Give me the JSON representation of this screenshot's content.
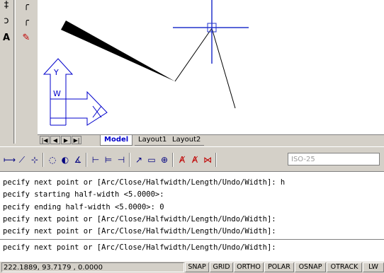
{
  "left_tools_a": [
    "‡",
    "ᴐ",
    "A"
  ],
  "left_tools_b": [
    "╭",
    "╭",
    "✎"
  ],
  "canvas": {
    "ucs_labels": {
      "y": "Y",
      "w": "W"
    }
  },
  "tabs": {
    "nav": [
      "|◀",
      "◀",
      "▶",
      "▶|"
    ],
    "items": [
      {
        "label": "Model"
      },
      {
        "label": "Layout1"
      },
      {
        "label": "Layout2"
      }
    ]
  },
  "dim_toolbar": {
    "buttons": [
      "⟼",
      "⟋",
      "⊹",
      "◌",
      "◐",
      "∡",
      "⊢",
      "⊨",
      "⊣",
      "↗",
      "▭",
      "⊕",
      "Ⱥ",
      "Ⱥ",
      "⋈"
    ],
    "style_value": "ISO-25"
  },
  "command_history": [
    "pecify next point or [Arc/Close/Halfwidth/Length/Undo/Width]: h",
    "pecify starting half-width <5.0000>:",
    "pecify ending half-width <5.0000>: 0",
    "pecify next point or [Arc/Close/Halfwidth/Length/Undo/Width]:",
    "pecify next point or [Arc/Close/Halfwidth/Length/Undo/Width]:"
  ],
  "command_prompt": "pecify next point or [Arc/Close/Halfwidth/Length/Undo/Width]:",
  "status": {
    "coordinates": "222.1889, 93.7179 , 0.0000",
    "toggles": [
      "SNAP",
      "GRID",
      "ORTHO",
      "POLAR",
      "OSNAP",
      "OTRACK",
      "LW"
    ]
  },
  "colors": {
    "ucs": "#0000cc",
    "crosshair": "#2233cc",
    "polyline": "#000000",
    "model_tab": "#0000cc"
  }
}
